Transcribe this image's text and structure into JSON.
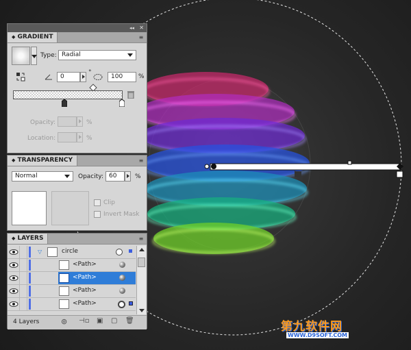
{
  "gradient_panel": {
    "title": "GRADIENT",
    "collapse_glyph": "◂◂",
    "close_glyph": "✕",
    "type_label": "Type:",
    "type_value": "Radial",
    "angle_value": "0",
    "angle_unit": "°",
    "aspect_value": "100",
    "aspect_unit": "%",
    "opacity_label": "Opacity:",
    "opacity_unit": "%",
    "location_label": "Location:",
    "location_unit": "%"
  },
  "transparency_panel": {
    "title": "TRANSPARENCY",
    "blend_mode": "Normal",
    "opacity_label": "Opacity:",
    "opacity_value": "60",
    "opacity_unit": "%",
    "clip_label": "Clip",
    "invert_mask_label": "Invert Mask"
  },
  "layers_panel": {
    "title": "LAYERS",
    "rows": [
      {
        "name": "circle",
        "kind": "layer",
        "selected": false
      },
      {
        "name": "<Path>",
        "kind": "path",
        "selected": false
      },
      {
        "name": "<Path>",
        "kind": "path",
        "selected": true
      },
      {
        "name": "<Path>",
        "kind": "path",
        "selected": false
      },
      {
        "name": "<Path>",
        "kind": "path",
        "selected": false
      }
    ],
    "footer_count": "4 Layers"
  },
  "watermark": {
    "brand": "第九软件网",
    "url": "WWW.D9SOFT.COM"
  },
  "colors": {
    "panel_bg": "#d6d6d6",
    "selection_blue": "#2f7dd8",
    "layer_color": "#4f6fe6",
    "watermark_orange": "#ff9a1a",
    "watermark_blue": "#2a64d8"
  }
}
